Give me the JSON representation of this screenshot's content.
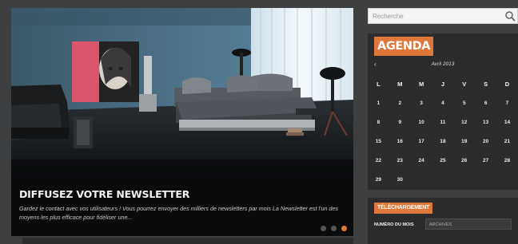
{
  "slider": {
    "title": "DIFFUSEZ VOTRE NEWSLETTER",
    "text": "Gardez le contact avec vos utilisateurs ! Vous pourrez envoyer des milliers de newsletters par mois La Newsletter est l'un des moyens les plus efficace pour fidéliser une...",
    "dots_count": 3,
    "active_dot": 3,
    "image": "bedroom-photo"
  },
  "search": {
    "placeholder": "Recherche",
    "icon": "search-icon"
  },
  "agenda": {
    "title": "AGENDA",
    "prev": "‹",
    "month": "Avril 2013",
    "weekdays": [
      "L",
      "M",
      "M",
      "J",
      "V",
      "S",
      "D"
    ],
    "weeks": [
      [
        "1",
        "2",
        "3",
        "4",
        "5",
        "6",
        "7"
      ],
      [
        "8",
        "9",
        "10",
        "11",
        "12",
        "13",
        "14"
      ],
      [
        "15",
        "16",
        "17",
        "18",
        "19",
        "20",
        "21"
      ],
      [
        "22",
        "23",
        "24",
        "25",
        "26",
        "27",
        "28"
      ],
      [
        "29",
        "30",
        "",
        "",
        "",
        "",
        ""
      ]
    ]
  },
  "download": {
    "title": "Téléchargement",
    "label": "NUMÉRO DU MOIS",
    "select_value": "ARCHIVES"
  },
  "colors": {
    "accent": "#e0773a",
    "background": "#3d3f40",
    "panel": "#2b2c2d"
  }
}
